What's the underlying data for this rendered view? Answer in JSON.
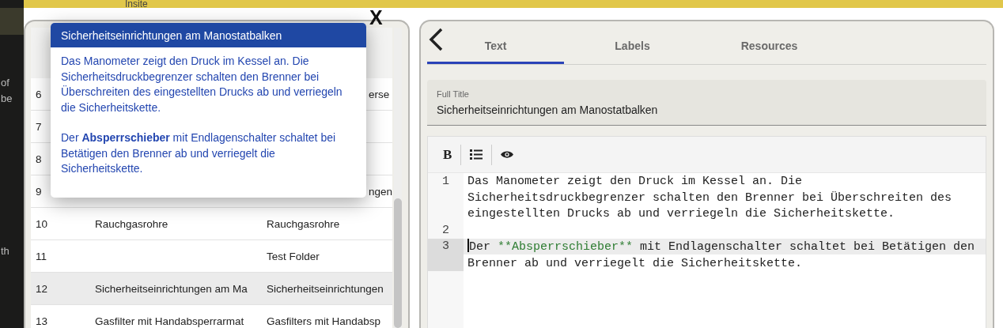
{
  "app_title": "Insite",
  "left_edge_texts": [
    "of",
    "be",
    "th"
  ],
  "table": {
    "rows": [
      {
        "number": "6",
        "column_3": "erse",
        "kind": "under-popup",
        "selected": false
      },
      {
        "number": "7",
        "selected": false
      },
      {
        "number": "8",
        "selected": false
      },
      {
        "number": "9",
        "column_3": "ngen",
        "kind": "under-popup",
        "selected": false
      },
      {
        "number": "10",
        "column_2": "Rauchgasrohre",
        "column_3": "Rauchgasrohre",
        "kind": "plain",
        "selected": false
      },
      {
        "number": "11",
        "column_3": "Test Folder",
        "kind": "plain",
        "selected": false
      },
      {
        "number": "12",
        "column_2": "Sicherheitseinrichtungen am Ma",
        "column_3": "Sicherheitseinrichtungen",
        "kind": "plain",
        "selected": true
      },
      {
        "number": "13",
        "column_2": "Gasfilter mit Handabsperrarmat",
        "column_3": "Gasfilters mit Handabsp",
        "kind": "plain",
        "selected": false
      }
    ]
  },
  "popup": {
    "title": "Sicherheitseinrichtungen am Manostatbalken",
    "paragraphs": [
      "Das Manometer zeigt den Druck im Kessel an. Die Sicherheitsdruckbegrenzer schalten den Brenner bei Überschreiten des eingestellten Drucks ab und verriegeln die Sicherheitskette.",
      "Der **Absperrschieber** mit Endlagenschalter schaltet bei Betätigen den Brenner ab und verriegelt die Sicherheitskette."
    ],
    "close": "X"
  },
  "editor": {
    "tabs": [
      {
        "label": "Text",
        "selected": true
      },
      {
        "label": "Labels",
        "selected": false
      },
      {
        "label": "Resources",
        "selected": false
      }
    ],
    "full_title": {
      "label": "Full Title",
      "value": "Sicherheitseinrichtungen am Manostatbalken"
    },
    "toolbar": {
      "bold": "B"
    },
    "lines": [
      {
        "number": "1",
        "active": false,
        "segments": [
          {
            "kind": "plain",
            "text": "Das Manometer zeigt den Druck im Kessel an. Die Sicherheitsdruckbegrenzer schalten den Brenner bei Überschreiten des eingestellten Drucks ab und verriegeln die Sicherheitskette."
          }
        ]
      },
      {
        "number": "2",
        "active": false
      },
      {
        "number": "3",
        "active": true,
        "segments": [
          {
            "kind": "plain",
            "text": "Der "
          },
          {
            "kind": "strong-markup",
            "text": "**Absperrschieber**"
          },
          {
            "kind": "plain",
            "text": " mit Endlagenschalter schaltet bei Betätigen den Brenner ab und verriegelt die Sicherheitskette."
          }
        ]
      }
    ]
  }
}
